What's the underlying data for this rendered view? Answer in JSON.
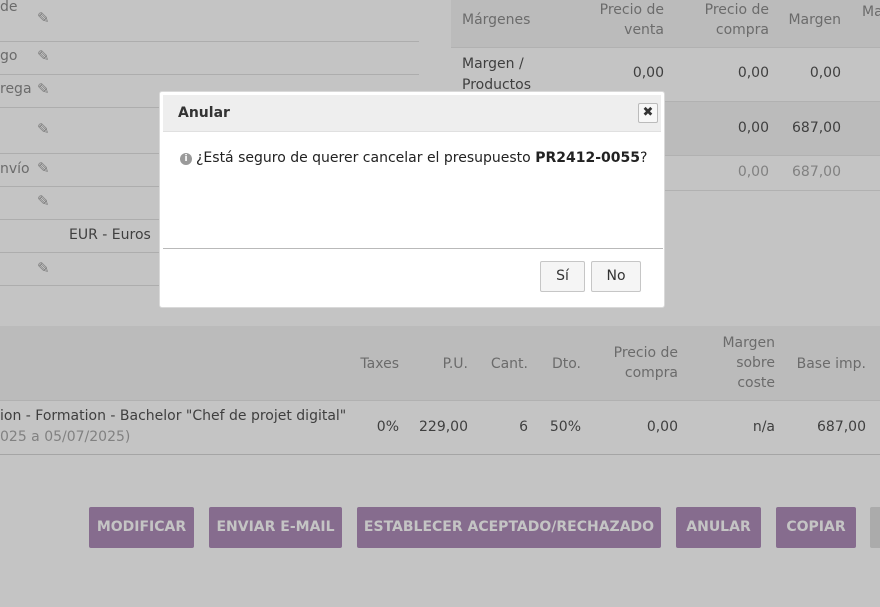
{
  "left_form": {
    "labels": [
      "de",
      "go",
      "rega",
      "",
      "nvío",
      "",
      "",
      ""
    ],
    "currency_value": "EUR - Euros"
  },
  "margins": {
    "headers": [
      "Márgenes",
      "Precio de venta",
      "Precio de compra",
      "Margen",
      "Ma"
    ],
    "rows": [
      {
        "label": "Margen / Productos",
        "venta": "0,00",
        "compra": "0,00",
        "margen": "0,00"
      },
      {
        "label": "",
        "venta": "",
        "compra": "0,00",
        "margen": "687,00"
      },
      {
        "label": "",
        "venta": "",
        "compra": "0,00",
        "margen": "687,00"
      }
    ]
  },
  "lines": {
    "headers": [
      "Taxes",
      "P.U.",
      "Cant.",
      "Dto.",
      "Precio de compra",
      "Margen sobre coste",
      "Base imp."
    ],
    "row": {
      "description": "ion - Formation - Bachelor \"Chef de projet digital\"",
      "dates": "025 a 05/07/2025)",
      "taxes": "0%",
      "pu": "229,00",
      "cant": "6",
      "dto": "50%",
      "precio_compra": "0,00",
      "margen_coste": "n/a",
      "base_imp": "687,00"
    }
  },
  "actions": {
    "modificar": "MODIFICAR",
    "enviar": "ENVIAR E-MAIL",
    "establecer": "ESTABLECER ACEPTADO/RECHAZADO",
    "anular": "ANULAR",
    "copiar": "COPIAR"
  },
  "dialog": {
    "title": "Anular",
    "close": "✖",
    "message_prefix": "¿Está seguro de querer cancelar el presupuesto ",
    "ref": "PR2412-0055",
    "message_suffix": "?",
    "yes": "Sí",
    "no": "No"
  },
  "colors": {
    "accent": "#a079ad",
    "header_bg": "#f2f2f2",
    "overlay": "rgba(85,85,85,0.35)"
  }
}
